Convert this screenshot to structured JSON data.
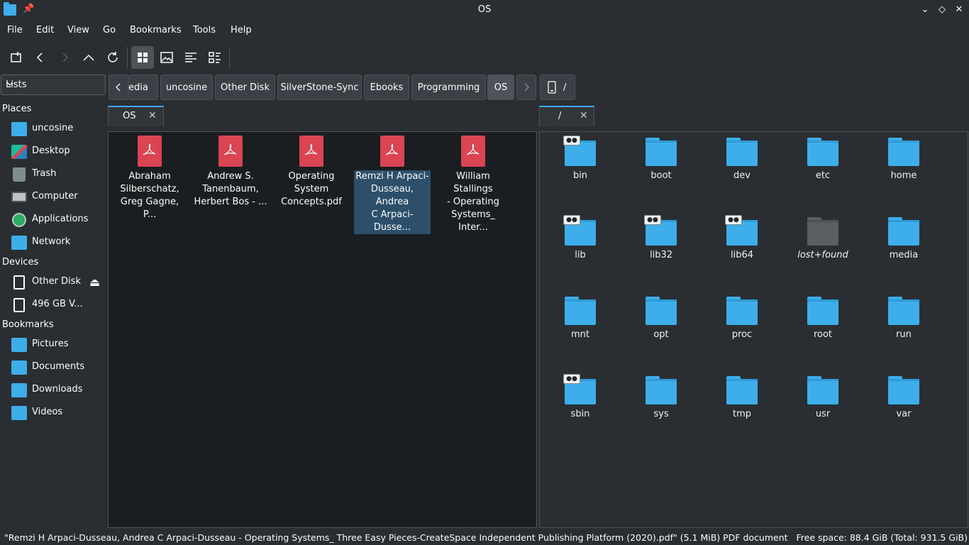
{
  "window": {
    "title": "OS"
  },
  "menubar": {
    "items": [
      "File",
      "Edit",
      "View",
      "Go",
      "Bookmarks",
      "Tools",
      "Help"
    ]
  },
  "places_dropdown": {
    "value": "Lists"
  },
  "breadcrumbs": {
    "items": [
      "edia",
      "uncosine",
      "Other Disk",
      "SilverStone-Sync",
      "Ebooks",
      "Programming",
      "OS"
    ]
  },
  "right_location": {
    "path": "/"
  },
  "sidebar": {
    "places_heading": "Places",
    "places": [
      "uncosine",
      "Desktop",
      "Trash",
      "Computer",
      "Applications",
      "Network"
    ],
    "devices_heading": "Devices",
    "devices": [
      "Other Disk",
      "496 GB V..."
    ],
    "bookmarks_heading": "Bookmarks",
    "bookmarks": [
      "Pictures",
      "Documents",
      "Downloads",
      "Videos"
    ]
  },
  "left_tab": {
    "label": "OS"
  },
  "right_tab": {
    "label": "/"
  },
  "left_files": [
    {
      "line1": "Abraham",
      "line2": "Silberschatz,",
      "line3": "Greg Gagne, P..."
    },
    {
      "line1": "Andrew S.",
      "line2": "Tanenbaum,",
      "line3": "Herbert Bos - ..."
    },
    {
      "line1": "Operating",
      "line2": "System",
      "line3": "Concepts.pdf"
    },
    {
      "line1": "Remzi H Arpaci-",
      "line2": "Dusseau, Andrea",
      "line3": "C Arpaci-Dusse..."
    },
    {
      "line1": "William Stallings",
      "line2": "- Operating",
      "line3": "Systems_ Inter..."
    }
  ],
  "right_folders": [
    {
      "name": "bin",
      "link": true
    },
    {
      "name": "boot"
    },
    {
      "name": "dev"
    },
    {
      "name": "etc"
    },
    {
      "name": "home"
    },
    {
      "name": "lib",
      "link": true
    },
    {
      "name": "lib32",
      "link": true
    },
    {
      "name": "lib64",
      "link": true
    },
    {
      "name": "lost+found",
      "gray": true
    },
    {
      "name": "media"
    },
    {
      "name": "mnt"
    },
    {
      "name": "opt"
    },
    {
      "name": "proc"
    },
    {
      "name": "root"
    },
    {
      "name": "run"
    },
    {
      "name": "sbin",
      "link": true
    },
    {
      "name": "sys"
    },
    {
      "name": "tmp"
    },
    {
      "name": "usr"
    },
    {
      "name": "var"
    }
  ],
  "statusbar": {
    "left": "\"Remzi H Arpaci-Dusseau, Andrea C Arpaci-Dusseau - Operating Systems_ Three Easy Pieces-CreateSpace Independent Publishing Platform (2020).pdf\" (5.1 MiB) PDF document",
    "right": "Free space: 88.4 GiB (Total: 931.5 GiB)"
  },
  "colors": {
    "accent": "#3daee9",
    "pdf": "#da4453",
    "background": "#2a2e32",
    "pane": "#1b1e20"
  }
}
